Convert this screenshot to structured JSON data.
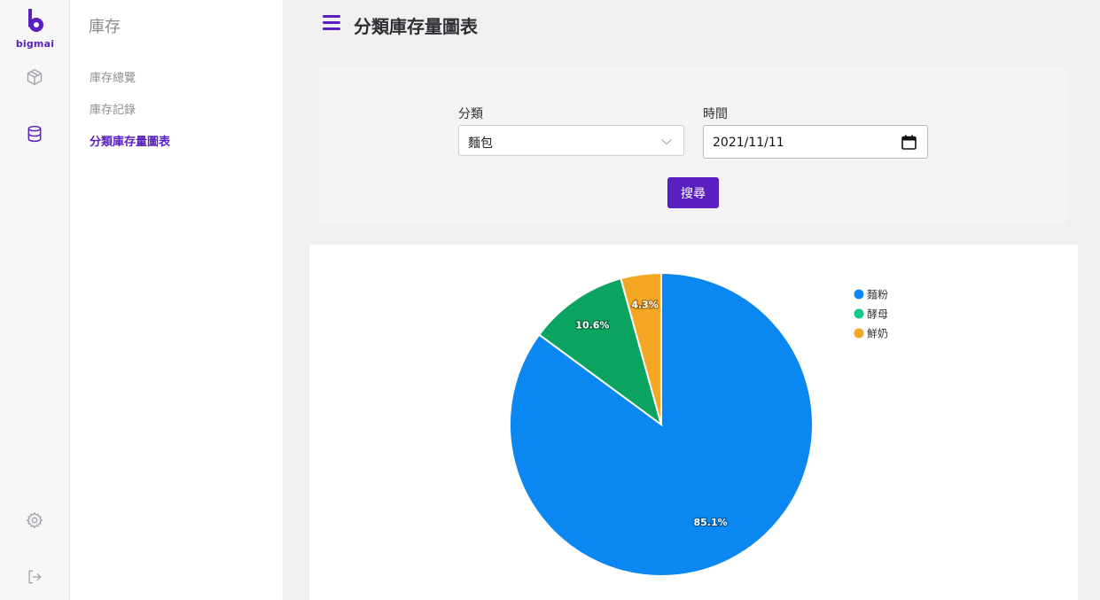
{
  "brand": {
    "name": "bigmai",
    "color": "#5a1fc1"
  },
  "rail": {
    "items": [
      {
        "icon": "cube-icon",
        "active": false
      },
      {
        "icon": "database-icon",
        "active": true
      }
    ],
    "bottom": [
      {
        "icon": "gear-icon"
      },
      {
        "icon": "logout-icon"
      }
    ]
  },
  "subnav": {
    "title": "庫存",
    "items": [
      {
        "label": "庫存總覽",
        "active": false
      },
      {
        "label": "庫存記錄",
        "active": false
      },
      {
        "label": "分類庫存量圖表",
        "active": true
      }
    ]
  },
  "header": {
    "title": "分類庫存量圖表"
  },
  "filter": {
    "category_label": "分類",
    "category_value": "麵包",
    "date_label": "時間",
    "date_value": "2021/11/11",
    "search_label": "搜尋"
  },
  "chart_data": {
    "type": "pie",
    "title": "",
    "legend_position": "top-right",
    "categories": [
      "麵粉",
      "酵母",
      "鮮奶"
    ],
    "values": [
      85.1,
      10.6,
      4.3
    ],
    "labels": [
      "85.1%",
      "10.6%",
      "4.3%"
    ],
    "colors": [
      "#0a87f0",
      "#0ba360",
      "#f5a623"
    ],
    "legend_colors": [
      "#0a87f0",
      "#13c98a",
      "#f5a623"
    ]
  }
}
